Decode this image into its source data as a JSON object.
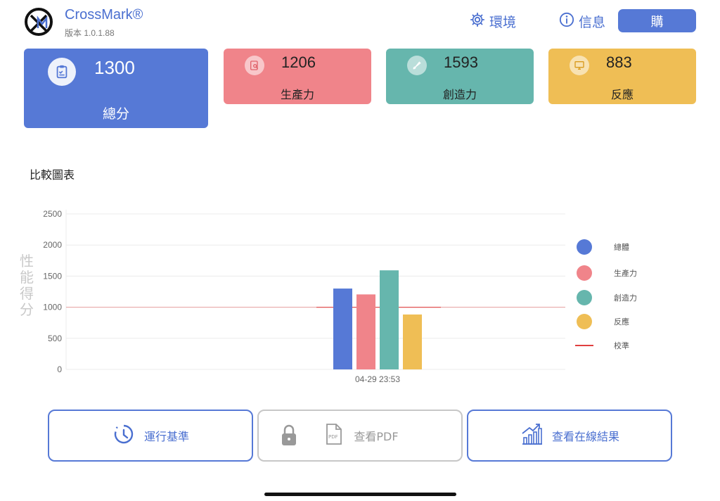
{
  "header": {
    "app_name": "CrossMark®",
    "version": "版本 1.0.1.88",
    "settings_label": "環境",
    "info_label": "信息",
    "buy_label": "購"
  },
  "cards": {
    "total": {
      "value": "1300",
      "label": "總分",
      "icon": "clipboard-check-icon"
    },
    "productivity": {
      "value": "1206",
      "label": "生產力",
      "icon": "document-search-icon"
    },
    "creativity": {
      "value": "1593",
      "label": "創造力",
      "icon": "brush-icon"
    },
    "responsiveness": {
      "value": "883",
      "label": "反應",
      "icon": "monitor-icon"
    }
  },
  "colors": {
    "accent": "#5679d6",
    "productivity": "#f0848a",
    "creativity": "#66b6ad",
    "responsiveness": "#efbe55",
    "calibration": "#e04040"
  },
  "chart_title": "比較圖表",
  "chart_data": {
    "type": "bar",
    "categories": [
      "04-29 23:53"
    ],
    "ylabel": "性能得分",
    "ylim": [
      0,
      2500
    ],
    "yticks": [
      "2500",
      "2000",
      "1500",
      "1000",
      "500",
      "0"
    ],
    "grid": true,
    "legend_placement": "right",
    "series": [
      {
        "name": "總體",
        "values": [
          1300
        ],
        "color": "#5679d6"
      },
      {
        "name": "生產力",
        "values": [
          1206
        ],
        "color": "#f0848a"
      },
      {
        "name": "創造力",
        "values": [
          1593
        ],
        "color": "#66b6ad"
      },
      {
        "name": "反應",
        "values": [
          883
        ],
        "color": "#efbe55"
      }
    ],
    "reference_line": {
      "name": "校準",
      "value": 1000,
      "color": "#e04040"
    }
  },
  "actions": {
    "run": {
      "label": "運行基準",
      "icon": "timer-icon"
    },
    "pdf": {
      "label": "查看PDF",
      "icon": "pdf-icon",
      "lock_icon": "lock-icon"
    },
    "online": {
      "label": "查看在線結果",
      "icon": "bar-chart-growth-icon"
    }
  }
}
